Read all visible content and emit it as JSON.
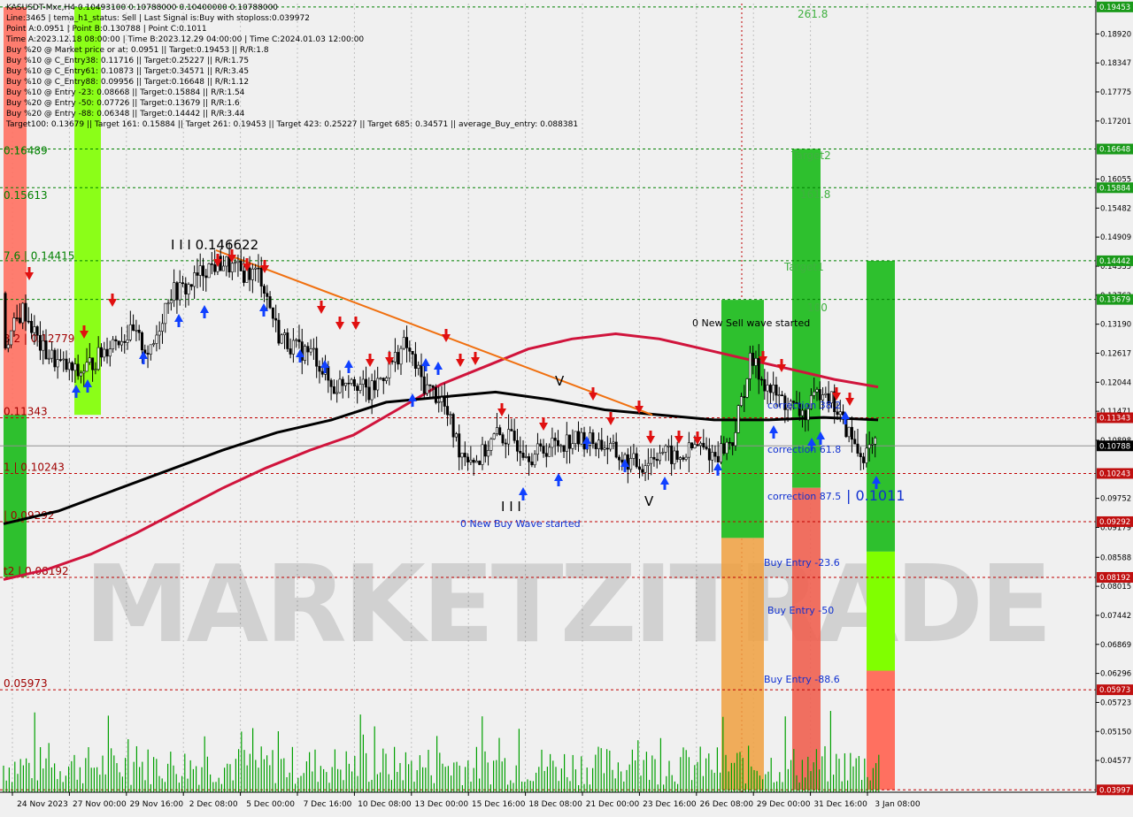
{
  "header": {
    "lines": [
      "KASUSDT-Mxc,H4  0.10493100 0.10788000 0.10400000 0.10788000",
      "Line:3465 | tema_h1_status: Sell | Last Signal is:Buy with stoploss:0.039972",
      "Point A:0.0951 | Point B:0.130788 | Point C:0.1011",
      "Time A:2023.12.18 08:00:00 | Time B:2023.12.29 04:00:00 | Time C:2024.01.03 12:00:00",
      "Buy %20 @ Market price or at: 0.0951 || Target:0.19453 || R/R:1.8",
      "Buy %10 @ C_Entry38: 0.11716 || Target:0.25227 || R/R:1.75",
      "Buy %10 @ C_Entry61: 0.10873 || Target:0.34571 || R/R:3.45",
      "Buy %10 @ C_Entry88: 0.09956 || Target:0.16648 || R/R:1.12",
      "Buy %10 @ Entry -23: 0.08668 || Target:0.15884 || R/R:1.54",
      "Buy %20 @ Entry -50: 0.07726 || Target:0.13679 || R/R:1.6",
      "Buy %20 @ Entry -88: 0.06348 || Target:0.14442 || R/R:3.44",
      "Target100: 0.13679 || Target 161: 0.15884 || Target 261: 0.19453 || Target 423: 0.25227 || Target 685: 0.34571 || average_Buy_entry: 0.088381"
    ]
  },
  "watermark": "MARKETZITRADE",
  "colors": {
    "background": "#f0f0f0",
    "grid": "#c0c0c0",
    "bull_candle": "#000000",
    "bear_candle": "#000000",
    "ma_red": "#d0143c",
    "ma_black": "#000000",
    "trendline": "#f07010",
    "level_line": "#c00000",
    "green_level_line": "#008000",
    "volume": "#00a000",
    "buy_arrow": "#1040ff",
    "sell_arrow": "#e01010",
    "green_zone": "#2ec02e",
    "lime_zone": "#80ff00",
    "red_zone": "#ff7060"
  },
  "chart_data": {
    "type": "candlestick",
    "symbol": "KASUSDT-Mxc",
    "timeframe": "H4",
    "ylim": [
      0.0395,
      0.1952
    ],
    "x_ticks": [
      "24 Nov 2023",
      "27 Nov 00:00",
      "29 Nov 16:00",
      "2 Dec 08:00",
      "5 Dec 00:00",
      "7 Dec 16:00",
      "10 Dec 08:00",
      "13 Dec 00:00",
      "15 Dec 16:00",
      "18 Dec 08:00",
      "21 Dec 00:00",
      "23 Dec 16:00",
      "26 Dec 08:00",
      "29 Dec 00:00",
      "31 Dec 16:00",
      "3 Jan 08:00"
    ],
    "y_ticks": [
      "0.18920",
      "0.18347",
      "0.17775",
      "0.17201",
      "0.16055",
      "0.15482",
      "0.14909",
      "0.14335",
      "0.13762",
      "0.13190",
      "0.12617",
      "0.12044",
      "0.11471",
      "0.10898",
      "0.09752",
      "0.09179",
      "0.08588",
      "0.08015",
      "0.07442",
      "0.06869",
      "0.06296",
      "0.05723",
      "0.05150",
      "0.04577"
    ],
    "highlighted_prices": [
      {
        "label": "0.19453",
        "value": 0.19453,
        "kind": "green"
      },
      {
        "label": "0.16648",
        "value": 0.16648,
        "kind": "green"
      },
      {
        "label": "0.15884",
        "value": 0.15884,
        "kind": "green"
      },
      {
        "label": "0.14442",
        "value": 0.14442,
        "kind": "green"
      },
      {
        "label": "0.13679",
        "value": 0.13679,
        "kind": "green"
      },
      {
        "label": "0.11343",
        "value": 0.11343,
        "kind": "red"
      },
      {
        "label": "0.10788",
        "value": 0.10788,
        "kind": "current"
      },
      {
        "label": "0.10243",
        "value": 0.10243,
        "kind": "red"
      },
      {
        "label": "0.09292",
        "value": 0.09292,
        "kind": "red"
      },
      {
        "label": "0.08192",
        "value": 0.08192,
        "kind": "red"
      },
      {
        "label": "0.05973",
        "value": 0.05973,
        "kind": "red"
      },
      {
        "label": "0.03997",
        "value": 0.03997,
        "kind": "red"
      }
    ],
    "left_level_labels": [
      {
        "text": "0.16489",
        "value": 0.16489
      },
      {
        "text": "0.15613",
        "value": 0.15613
      },
      {
        "text": "7.6 | 0.14415",
        "value": 0.14415
      },
      {
        "text": "3.2 | 0.12779",
        "value": 0.12779
      },
      {
        "text": "0.11343",
        "value": 0.11343
      },
      {
        "text": "1 | 0.10243",
        "value": 0.10243
      },
      {
        "text": "| 0.09292",
        "value": 0.09292
      },
      {
        "text": "t2 | 0.08192",
        "value": 0.08192
      },
      {
        "text": "0.05973",
        "value": 0.05973
      }
    ],
    "annotations": [
      {
        "text": "261.8",
        "kind": "green"
      },
      {
        "text": "Target2",
        "kind": "green"
      },
      {
        "text": "161.8",
        "kind": "green"
      },
      {
        "text": "Target1",
        "kind": "green"
      },
      {
        "text": "100",
        "kind": "green"
      },
      {
        "text": "0 New Sell wave started",
        "kind": "black"
      },
      {
        "text": "correction 38.2",
        "kind": "blue"
      },
      {
        "text": "correction 61.8",
        "kind": "blue"
      },
      {
        "text": "correction 87.5",
        "kind": "blue"
      },
      {
        "text": "| 0.1011",
        "kind": "blue"
      },
      {
        "text": "Buy Entry -23.6",
        "kind": "blue"
      },
      {
        "text": "Buy Entry -50",
        "kind": "blue"
      },
      {
        "text": "Buy Entry -88.6",
        "kind": "blue"
      },
      {
        "text": "0 New Buy Wave started",
        "kind": "blue"
      },
      {
        "text": "I I I 0.146622",
        "kind": "black"
      },
      {
        "text": "V",
        "kind": "black"
      },
      {
        "text": "V",
        "kind": "black"
      },
      {
        "text": "I I I",
        "kind": "black"
      }
    ],
    "candle_anchors": [
      [
        0.138,
        0.128
      ],
      [
        0.14,
        0.135
      ],
      [
        0.135,
        0.127
      ],
      [
        0.127,
        0.124
      ],
      [
        0.12,
        0.122
      ],
      [
        0.124,
        0.125
      ],
      [
        0.132,
        0.129
      ],
      [
        0.131,
        0.13
      ],
      [
        0.128,
        0.126
      ],
      [
        0.134,
        0.138
      ],
      [
        0.138,
        0.139
      ],
      [
        0.14,
        0.143
      ],
      [
        0.141,
        0.144
      ],
      [
        0.146,
        0.142
      ],
      [
        0.141,
        0.142
      ],
      [
        0.136,
        0.13
      ],
      [
        0.128,
        0.127
      ],
      [
        0.127,
        0.126
      ],
      [
        0.126,
        0.119
      ],
      [
        0.123,
        0.122
      ],
      [
        0.117,
        0.118
      ],
      [
        0.118,
        0.123
      ],
      [
        0.126,
        0.128
      ],
      [
        0.122,
        0.12
      ],
      [
        0.121,
        0.117
      ],
      [
        0.112,
        0.107
      ],
      [
        0.101,
        0.105
      ],
      [
        0.107,
        0.11
      ],
      [
        0.104,
        0.109
      ],
      [
        0.11,
        0.106
      ],
      [
        0.106,
        0.108
      ],
      [
        0.113,
        0.109
      ],
      [
        0.111,
        0.109
      ],
      [
        0.104,
        0.108
      ],
      [
        0.109,
        0.105
      ],
      [
        0.102,
        0.104
      ],
      [
        0.106,
        0.107
      ],
      [
        0.104,
        0.105
      ],
      [
        0.108,
        0.108
      ],
      [
        0.11,
        0.106
      ],
      [
        0.106,
        0.109
      ],
      [
        0.127,
        0.125
      ],
      [
        0.123,
        0.119
      ],
      [
        0.12,
        0.116
      ],
      [
        0.117,
        0.114
      ],
      [
        0.121,
        0.12
      ],
      [
        0.119,
        0.113
      ],
      [
        0.103,
        0.106
      ],
      [
        0.106,
        0.108
      ]
    ],
    "ma_red": [
      0.0815,
      0.0835,
      0.0865,
      0.0905,
      0.095,
      0.0995,
      0.1035,
      0.107,
      0.11,
      0.115,
      0.12,
      0.1235,
      0.127,
      0.129,
      0.13,
      0.129,
      0.127,
      0.125,
      0.123,
      0.121,
      0.1195
    ],
    "ma_black": [
      0.0925,
      0.095,
      0.099,
      0.103,
      0.107,
      0.1105,
      0.113,
      0.1165,
      0.1175,
      0.1185,
      0.117,
      0.115,
      0.114,
      0.113,
      0.113,
      0.1135,
      0.113
    ],
    "trendline": [
      [
        0.1465,
        0.1465
      ],
      [
        0.114,
        0.114
      ]
    ],
    "volume_scale_note": "volume histogram at bottom"
  }
}
